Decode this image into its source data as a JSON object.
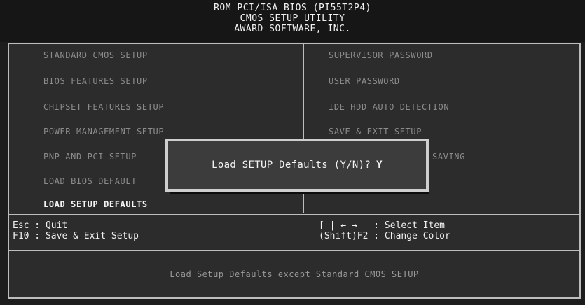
{
  "header": {
    "line1": "ROM PCI/ISA BIOS (PI55T2P4)",
    "line2": "CMOS SETUP UTILITY",
    "line3": "AWARD SOFTWARE, INC."
  },
  "menu": {
    "left": [
      "STANDARD CMOS SETUP",
      "BIOS FEATURES SETUP",
      "CHIPSET FEATURES SETUP",
      "POWER MANAGEMENT SETUP",
      "PNP AND PCI SETUP",
      "LOAD BIOS DEFAULT",
      "LOAD SETUP DEFAULTS"
    ],
    "right": [
      "SUPERVISOR PASSWORD",
      "USER PASSWORD",
      "IDE HDD AUTO DETECTION",
      "SAVE & EXIT SETUP",
      "SAVING"
    ],
    "selected_index": 6
  },
  "help": {
    "esc": "Esc : Quit",
    "f10": "F10 : Save & Exit Setup",
    "select": "[ | ← →   : Select Item",
    "color": "(Shift)F2 : Change Color"
  },
  "dialog": {
    "prompt": "Load SETUP Defaults (Y/N)?",
    "cursor_value": "Y"
  },
  "status_text": "Load Setup Defaults except Standard CMOS SETUP"
}
